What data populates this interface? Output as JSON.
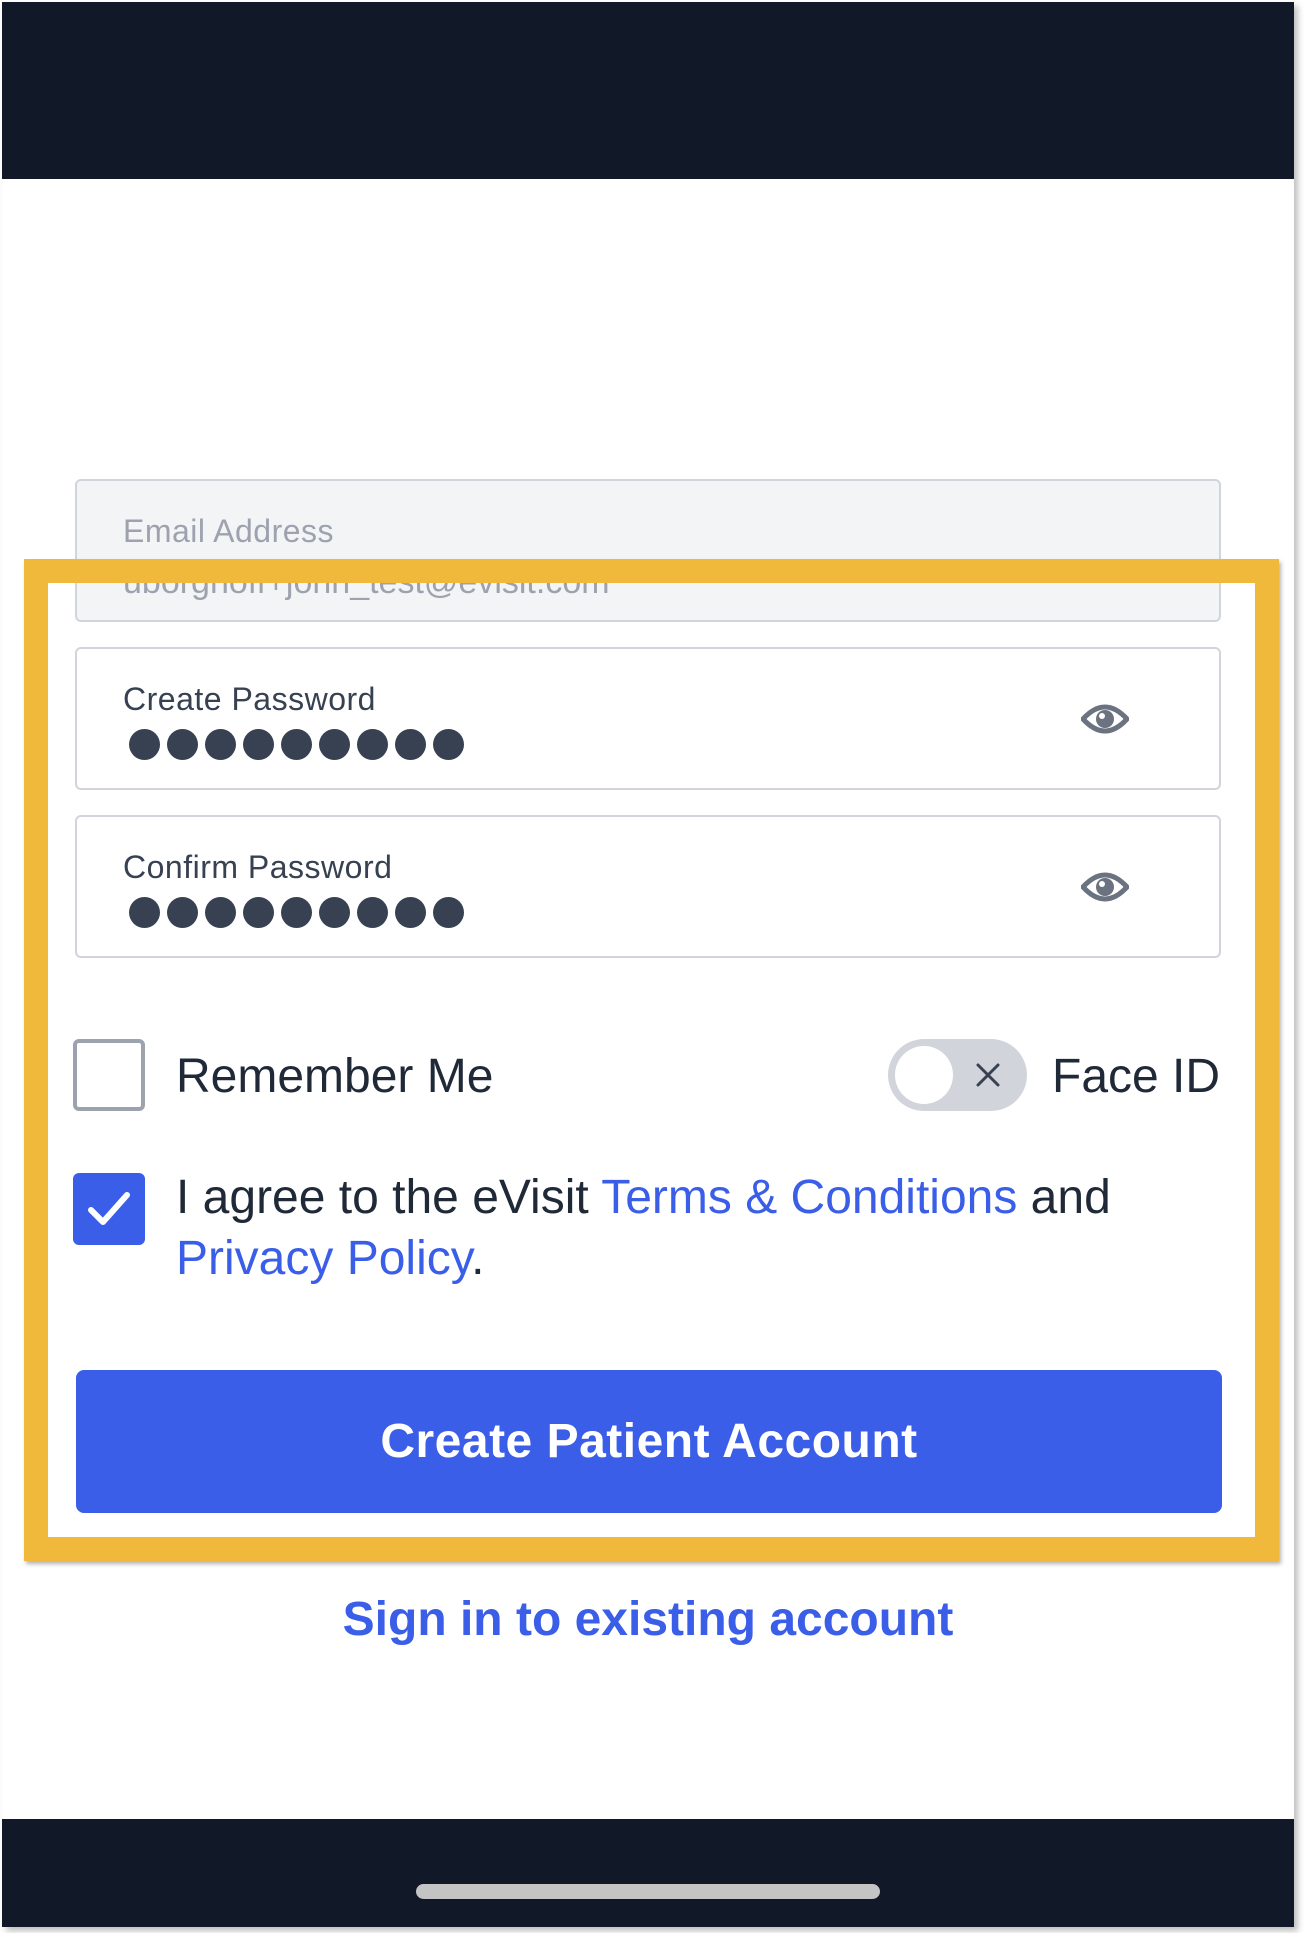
{
  "form": {
    "email": {
      "label": "Email Address",
      "value": "uborghoff+john_test@evisit.com"
    },
    "create_password": {
      "label": "Create Password",
      "dot_count": 9
    },
    "confirm_password": {
      "label": "Confirm Password",
      "dot_count": 9
    },
    "remember_me": {
      "label": "Remember Me",
      "checked": false
    },
    "face_id": {
      "label": "Face ID",
      "enabled": false
    },
    "agreement": {
      "checked": true,
      "text_before": "I agree to the eVisit ",
      "terms_link": "Terms & Conditions",
      "text_middle": " and ",
      "privacy_link": "Privacy Policy",
      "text_after": "."
    },
    "submit_label": "Create Patient Account",
    "signin_label": "Sign in to existing account"
  },
  "colors": {
    "accent": "#3a5ee8",
    "system_bar": "#111827",
    "highlight": "#f0b93b"
  },
  "icons": {
    "password_toggle": "eye-icon",
    "face_id_off": "close-icon",
    "checkbox_checked": "checkmark-icon"
  }
}
